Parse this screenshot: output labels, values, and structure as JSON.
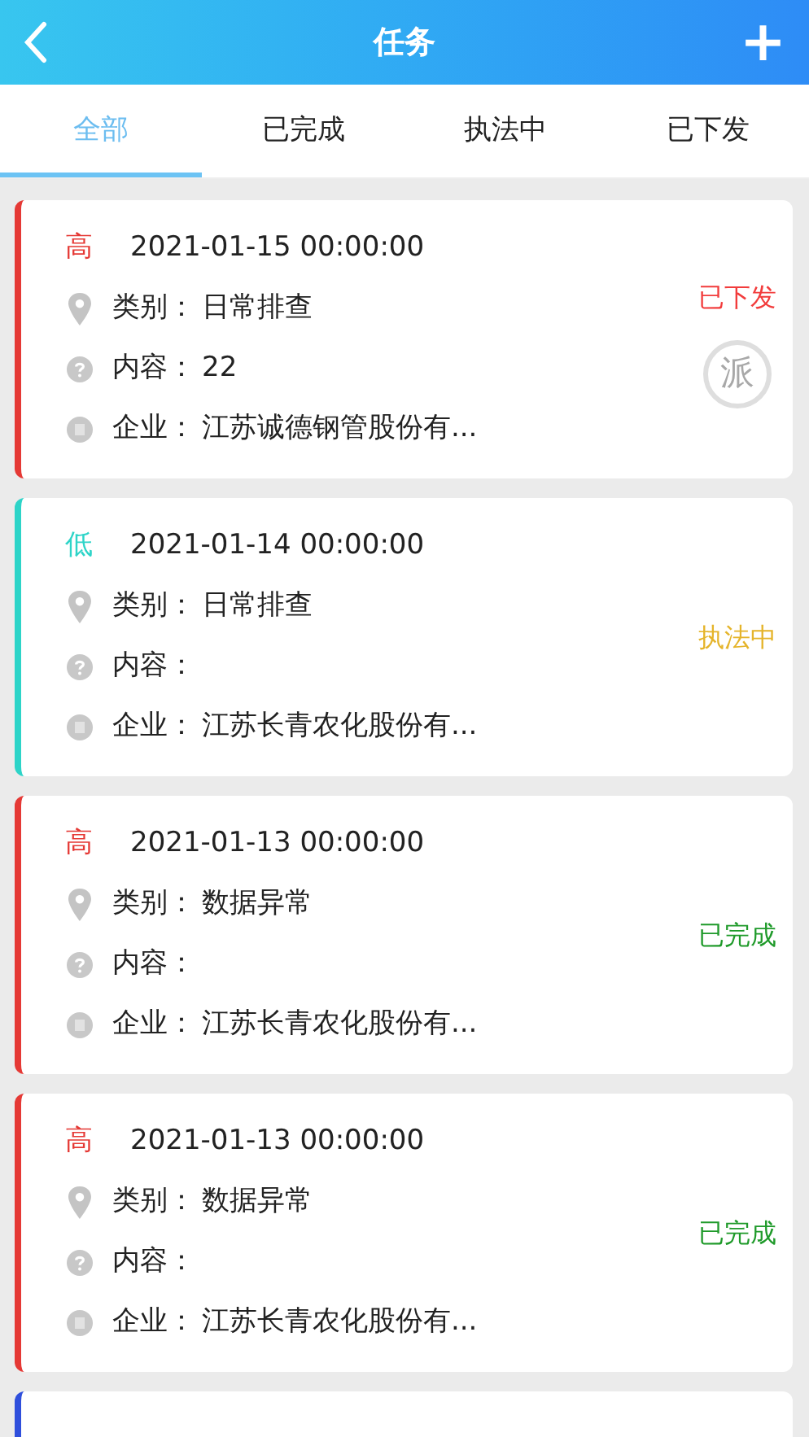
{
  "header": {
    "title": "任务",
    "add": "+"
  },
  "tabs": [
    {
      "label": "全部",
      "selected": true
    },
    {
      "label": "已完成",
      "selected": false
    },
    {
      "label": "执法中",
      "selected": false
    },
    {
      "label": "已下发",
      "selected": false
    }
  ],
  "tasks": [
    {
      "priority": "高",
      "color": "#e53935",
      "date": "2021-01-15 00:00:00",
      "category_label": "类别：",
      "category": "日常排查",
      "content_label": "内容：",
      "content": "22",
      "company_label": "企业：",
      "company": "江苏诚德钢管股份有...",
      "status": {
        "label": "已下发",
        "color": "#f23c3c"
      },
      "stamp": "派"
    },
    {
      "priority": "低",
      "color": "#2dd4c8",
      "date": "2021-01-14 00:00:00",
      "category_label": "类别：",
      "category": "日常排查",
      "content_label": "内容：",
      "company_label": "企业：",
      "company": "江苏长青农化股份有...",
      "status": {
        "label": "执法中",
        "color": "#e5b42a"
      }
    },
    {
      "priority": "高",
      "color": "#e53935",
      "date": "2021-01-13 00:00:00",
      "category_label": "类别：",
      "category": "数据异常",
      "content_label": "内容：",
      "company_label": "企业：",
      "company": "江苏长青农化股份有...",
      "status": {
        "label": "已完成",
        "color": "#1f9a2a"
      }
    },
    {
      "priority": "高",
      "color": "#e53935",
      "date": "2021-01-13 00:00:00",
      "category_label": "类别：",
      "category": "数据异常",
      "content_label": "内容：",
      "company_label": "企业：",
      "company": "江苏长青农化股份有...",
      "status": {
        "label": "已完成",
        "color": "#1f9a2a"
      }
    },
    {
      "color": "#2f4fdc"
    }
  ]
}
